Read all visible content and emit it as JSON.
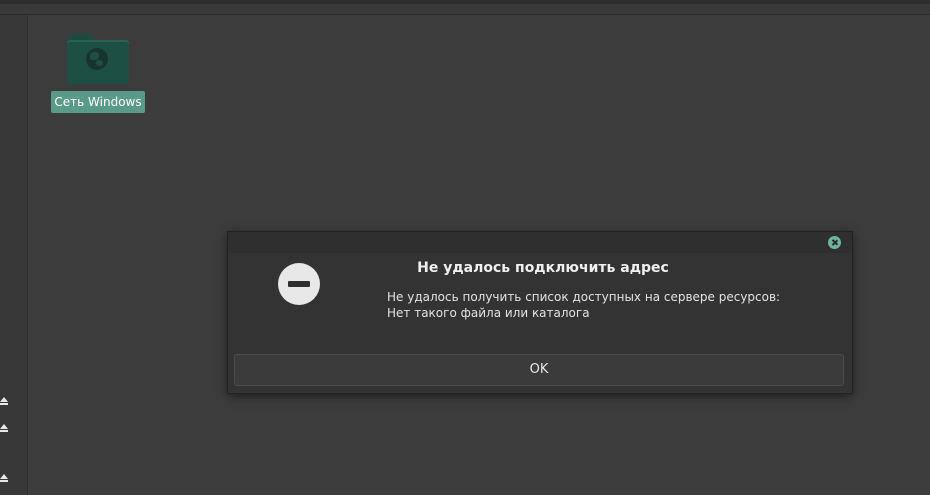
{
  "desktop": {
    "icons": [
      {
        "label": "Сеть Windows",
        "icon": "network-folder-icon"
      }
    ]
  },
  "sidebar": {
    "eject_icons": [
      "eject-icon",
      "eject-icon",
      "eject-icon"
    ]
  },
  "dialog": {
    "title": "Не удалось подключить адрес",
    "message": "Не удалось получить список доступных на сервере ресурсов: Нет такого файла или каталога",
    "ok_label": "OK",
    "icon": "error-icon",
    "close_icon": "close-icon"
  },
  "colors": {
    "accent": "#6fb3a3",
    "selection": "#5a9a88",
    "background": "#3c3c3c",
    "dialog_background": "#333333"
  }
}
